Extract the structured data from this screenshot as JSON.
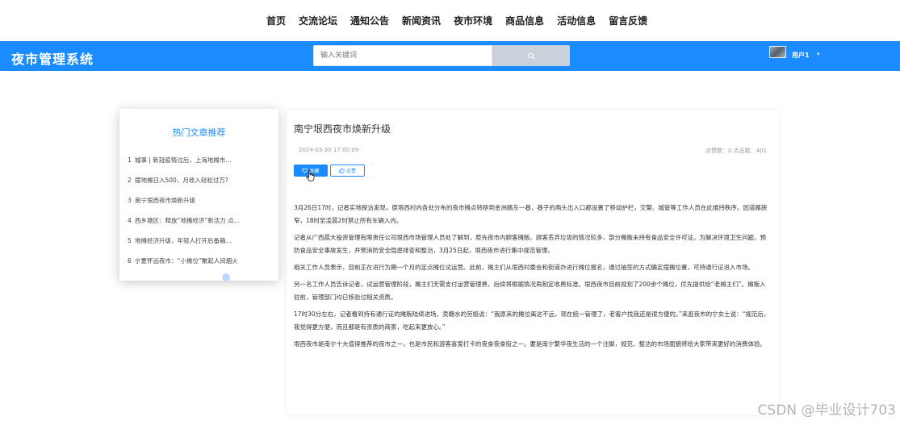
{
  "nav": {
    "items": [
      "首页",
      "交流论坛",
      "通知公告",
      "新闻资讯",
      "夜市环境",
      "商品信息",
      "活动信息",
      "留言反馈"
    ]
  },
  "header": {
    "brand": "夜市管理系统",
    "search_placeholder": "输入关键词",
    "search_icon": "search-icon",
    "user_name": "用户1",
    "user_caret": "▾",
    "colors": {
      "bar": "#1a8cff",
      "search_button": "#c9d1da"
    }
  },
  "sidebar": {
    "title": "热门文章推荐",
    "items": [
      {
        "num": "1",
        "text": "城事 | 新冠疫情过后，上海地摊市…"
      },
      {
        "num": "2",
        "text": "摆地摊日入500，月收入轻松过万?"
      },
      {
        "num": "3",
        "text": "南宁垠西夜市焕新升级"
      },
      {
        "num": "4",
        "text": "西乡塘区：释放“地摊经济”新活力 点…"
      },
      {
        "num": "5",
        "text": "地摊经济升级，年轻人打开后备箱…"
      },
      {
        "num": "6",
        "text": "宁夏怀远夜市：“小摊位”聚起人间烟火"
      }
    ]
  },
  "article": {
    "title": "南宁垠西夜市焕新升级",
    "date": "2024-03-30 17:00:09",
    "stats": "点赞数：0    点击数：401",
    "fav_label": "收藏",
    "like_label": "点赞",
    "fav_icon": "heart-icon",
    "like_icon": "thumbs-up-icon",
    "paragraphs": [
      "3月26日17时，记者实地探访发现，原垠西村内各处分布的夜市摊点转移到金洲路东一巷，巷子的两头出入口都设置了移动护栏，交警、城管等工作人员在此维持秩序。因道路狭窄，18时至凌晨2时禁止所有车辆入内。",
      "记者从广西晨大投资管理有限责任公司垠西市场管理人员处了解到，原先夜市内顾客摊贩、顾客丢弃垃圾的情况较多，部分摊贩未持有食品安全许可证。为解决环境卫生问题，预防食品安全事故发生，并预消防安全隐患排查和整治，3月25日起，垠西夜市进行集中规范管理。",
      "相关工作人员表示，目前正在进行为期一个月的定点摊位试运营。此前，摊主们从垠西村委会和街道办进行摊位报名，通过抽签的方式确定摆摊位置，可持通行证进入市场。",
      "另一名工作人员告诉记者，试运营管理阶段，摊主们无需支付运营管理费，后续将根据情况再制定收费标准。垠西夜市目前规划了200余个摊位，优先提供给“老摊主们”。摊贩入驻前，管理部门均已核验过相关资质。",
      "17时30分左右，记者看到持有通行证的摊贩陆续进场。卖糖水的劳姐说：“我原来的摊位离这不远，现在统一管理了，老客户找我还是很方便的。”来逛夜市的宁女士说：“规范后，我觉得更方便，而且都是有资质的商家，吃起来更放心。”",
      "垠西夜市是南宁十大值得推荐的夜市之一，也是市民和游客喜爱打卡的夜食夜食街之一。要是南宁繁华夜生活的一个注脚，规范、整洁的市场面貌将给大家带来更好的消费体验。"
    ]
  },
  "watermark": "CSDN @毕业设计703"
}
